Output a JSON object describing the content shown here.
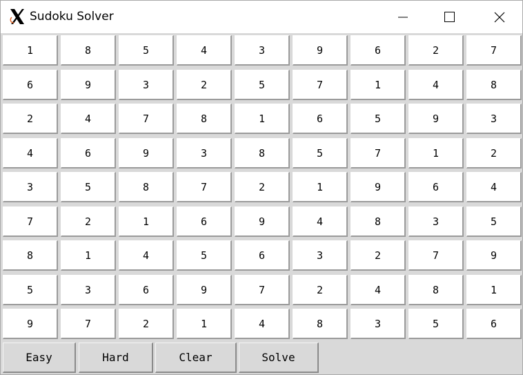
{
  "window": {
    "title": "Sudoku Solver",
    "icon": "x-window-icon",
    "controls": [
      "minimize-icon",
      "maximize-icon",
      "close-icon"
    ]
  },
  "board": [
    [
      "1",
      "8",
      "5",
      "4",
      "3",
      "9",
      "6",
      "2",
      "7"
    ],
    [
      "6",
      "9",
      "3",
      "2",
      "5",
      "7",
      "1",
      "4",
      "8"
    ],
    [
      "2",
      "4",
      "7",
      "8",
      "1",
      "6",
      "5",
      "9",
      "3"
    ],
    [
      "4",
      "6",
      "9",
      "3",
      "8",
      "5",
      "7",
      "1",
      "2"
    ],
    [
      "3",
      "5",
      "8",
      "7",
      "2",
      "1",
      "9",
      "6",
      "4"
    ],
    [
      "7",
      "2",
      "1",
      "6",
      "9",
      "4",
      "8",
      "3",
      "5"
    ],
    [
      "8",
      "1",
      "4",
      "5",
      "6",
      "3",
      "2",
      "7",
      "9"
    ],
    [
      "5",
      "3",
      "6",
      "9",
      "7",
      "2",
      "4",
      "8",
      "1"
    ],
    [
      "9",
      "7",
      "2",
      "1",
      "4",
      "8",
      "3",
      "5",
      "6"
    ]
  ],
  "buttons": {
    "easy": "Easy",
    "hard": "Hard",
    "clear": "Clear",
    "solve": "Solve"
  }
}
